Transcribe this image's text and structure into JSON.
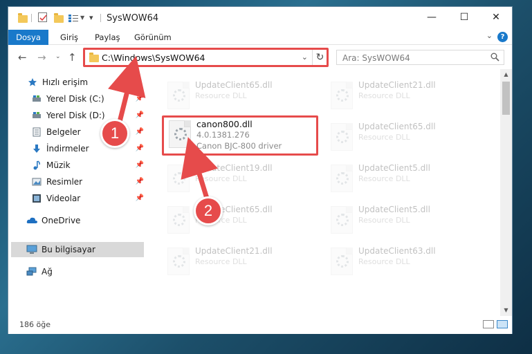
{
  "window": {
    "title": "SysWOW64",
    "minimize": "—",
    "maximize": "☐",
    "close": "✕"
  },
  "ribbon": {
    "tabs": [
      "Dosya",
      "Giriş",
      "Paylaş",
      "Görünüm"
    ],
    "help": "?"
  },
  "address": {
    "path": "C:\\Windows\\SysWOW64",
    "refresh": "↻"
  },
  "search": {
    "placeholder": "Ara: SysWOW64"
  },
  "sidebar": {
    "items": [
      {
        "label": "Hızlı erişim",
        "icon": "star-icon",
        "pinned": false
      },
      {
        "label": "Yerel Disk (C:)",
        "icon": "drive-icon",
        "pinned": true
      },
      {
        "label": "Yerel Disk (D:)",
        "icon": "drive-icon",
        "pinned": true
      },
      {
        "label": "Belgeler",
        "icon": "document-icon",
        "pinned": true
      },
      {
        "label": "İndirmeler",
        "icon": "download-icon",
        "pinned": true
      },
      {
        "label": "Müzik",
        "icon": "music-icon",
        "pinned": true
      },
      {
        "label": "Resimler",
        "icon": "picture-icon",
        "pinned": true
      },
      {
        "label": "Videolar",
        "icon": "video-icon",
        "pinned": true
      },
      {
        "label": "OneDrive",
        "icon": "cloud-icon",
        "pinned": false
      },
      {
        "label": "Bu bilgisayar",
        "icon": "computer-icon",
        "pinned": false,
        "selected": true
      },
      {
        "label": "Ağ",
        "icon": "network-icon",
        "pinned": false
      }
    ]
  },
  "files": {
    "highlighted": {
      "name": "canon800.dll",
      "version": "4.0.1381.276",
      "description": "Canon BJC-800 driver"
    },
    "background_left": [
      {
        "name": "UpdateClient65.dll",
        "type": "Resource DLL"
      },
      {
        "name": "UpdateClient19.dll",
        "type": "Resource DLL"
      },
      {
        "name": "UpdateClient65.dll",
        "type": "Resource DLL"
      },
      {
        "name": "UpdateClient21.dll",
        "type": "Resource DLL"
      }
    ],
    "background_right": [
      {
        "name": "UpdateClient21.dll",
        "type": "Resource DLL"
      },
      {
        "name": "UpdateClient65.dll",
        "type": "Resource DLL"
      },
      {
        "name": "UpdateClient5.dll",
        "type": "Resource DLL"
      },
      {
        "name": "UpdateClient5.dll",
        "type": "Resource DLL"
      },
      {
        "name": "UpdateClient63.dll",
        "type": "Resource DLL"
      }
    ]
  },
  "status": {
    "count": "186 öğe"
  },
  "annotations": {
    "step1": "1",
    "step2": "2",
    "color": "#e64b4b"
  }
}
